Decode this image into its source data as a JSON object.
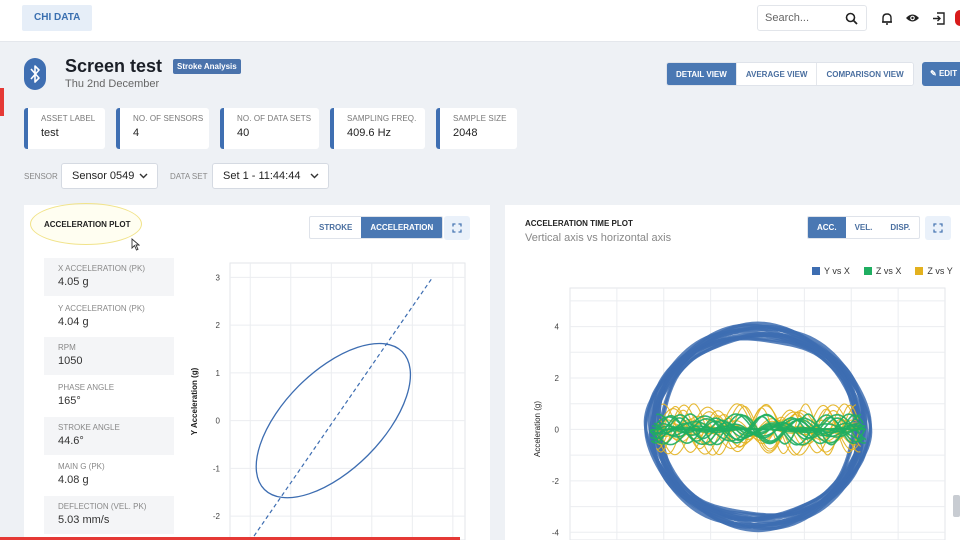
{
  "app": {
    "brand": "CHI DATA"
  },
  "search": {
    "placeholder": "Search..."
  },
  "header": {
    "title": "Screen test",
    "tag": "Stroke Analysis",
    "subtitle": "Thu 2nd December",
    "view_tabs": [
      "DETAIL VIEW",
      "AVERAGE VIEW",
      "COMPARISON VIEW"
    ],
    "active_view": "DETAIL VIEW",
    "edit_label": "EDIT"
  },
  "stats": [
    {
      "label": "ASSET LABEL",
      "value": "test"
    },
    {
      "label": "NO. OF SENSORS",
      "value": "4"
    },
    {
      "label": "NO. OF DATA SETS",
      "value": "40"
    },
    {
      "label": "SAMPLING FREQ.",
      "value": "409.6 Hz"
    },
    {
      "label": "SAMPLE SIZE",
      "value": "2048"
    }
  ],
  "filters": {
    "sensor_label": "SENSOR",
    "sensor_value": "Sensor 0549",
    "dataset_label": "DATA SET",
    "dataset_value": "Set 1 - 11:44:44"
  },
  "left_panel": {
    "title": "ACCELERATION PLOT",
    "tabs": [
      "STROKE",
      "ACCELERATION"
    ],
    "active_tab": "ACCELERATION",
    "metrics": [
      {
        "label": "X ACCELERATION (PK)",
        "value": "4.05 g"
      },
      {
        "label": "Y ACCELERATION (PK)",
        "value": "4.04 g"
      },
      {
        "label": "RPM",
        "value": "1050"
      },
      {
        "label": "PHASE ANGLE",
        "value": "165°"
      },
      {
        "label": "STROKE ANGLE",
        "value": "44.6°"
      },
      {
        "label": "MAIN G (PK)",
        "value": "4.08 g"
      },
      {
        "label": "DEFLECTION (VEL. PK)",
        "value": "5.03 mm/s"
      }
    ]
  },
  "right_panel": {
    "title": "ACCELERATION TIME PLOT",
    "subtitle": "Vertical axis vs horizontal axis",
    "tabs": [
      "ACC.",
      "VEL.",
      "DISP."
    ],
    "active_tab": "ACC."
  },
  "colors": {
    "accent": "#4a78b3",
    "series_y_vs_x": "#3d6db1",
    "series_z_vs_x": "#1fae61",
    "series_z_vs_y": "#e3b11e"
  },
  "chart_data": [
    {
      "type": "line",
      "ylabel": "Y Acceleration (g)",
      "xlabel": "",
      "ylim": [
        -2.5,
        3.3
      ],
      "y_ticks": [
        "3",
        "2",
        "1",
        "0",
        "-1",
        "-2"
      ],
      "grid": true,
      "series": [
        {
          "kind": "ellipse-orbit",
          "center": [
            0,
            0
          ],
          "y_range": [
            -2,
            2
          ],
          "x_range": [
            -1.9,
            2.0
          ],
          "tilt_deg": 45
        },
        {
          "kind": "dashed-reference-line",
          "points": [
            [
              -2.3,
              -2.9
            ],
            [
              2.5,
              3.0
            ]
          ]
        }
      ]
    },
    {
      "type": "line",
      "title": "ACCELERATION TIME PLOT",
      "ylabel": "Acceleration (g)",
      "y_ticks": [
        "4",
        "2",
        "0",
        "-2",
        "-4"
      ],
      "ylim": [
        -4.3,
        5.5
      ],
      "legend": "top-right",
      "grid": true,
      "series": [
        {
          "name": "Y vs X",
          "kind": "orbit",
          "x_amplitude": 4.0,
          "y_amplitude": 4.0
        },
        {
          "name": "Z vs X",
          "kind": "orbit",
          "x_amplitude": 4.0,
          "y_amplitude": 0.6
        },
        {
          "name": "Z vs Y",
          "kind": "orbit",
          "x_amplitude": 3.8,
          "y_amplitude": 1.0
        }
      ]
    }
  ]
}
